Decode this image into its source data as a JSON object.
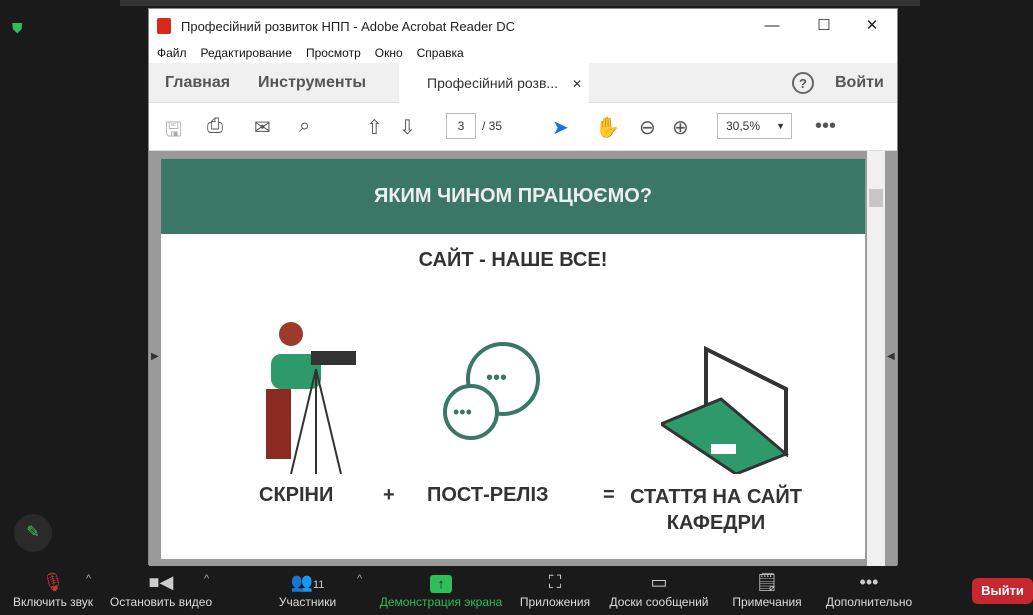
{
  "window": {
    "title": "Професійний розвиток НПП - Adobe Acrobat Reader DC",
    "minimize": "—",
    "maximize": "☐",
    "close": "✕"
  },
  "menu": [
    "Файл",
    "Редактирование",
    "Просмотр",
    "Окно",
    "Справка"
  ],
  "tabs": {
    "home": "Главная",
    "tools": "Инструменты",
    "doc": "Професійний розв...",
    "doc_close": "✕",
    "help": "?",
    "signin": "Войти"
  },
  "toolbar": {
    "page": "3",
    "total": "/ 35",
    "zoom": "30,5%"
  },
  "slide": {
    "banner": "ЯКИМ ЧИНОМ ПРАЦЮЄМО?",
    "subtitle": "САЙТ - НАШЕ ВСЕ!",
    "items": [
      "СКРІНИ",
      "+",
      "ПОСТ-РЕЛІЗ",
      "=",
      "СТАТТЯ НА САЙТ КАФЕДРИ"
    ]
  },
  "zoom_bar": {
    "items": [
      {
        "label": "Включить звук",
        "icon": "mic-muted-icon"
      },
      {
        "label": "Остановить видео",
        "icon": "video-icon"
      },
      {
        "label": "Участники",
        "icon": "participants-icon",
        "count": "11"
      },
      {
        "label": "Демонстрация экрана",
        "icon": "share-screen-icon"
      },
      {
        "label": "Приложения",
        "icon": "apps-icon"
      },
      {
        "label": "Доски сообщений",
        "icon": "whiteboard-icon"
      },
      {
        "label": "Примечания",
        "icon": "notes-icon"
      },
      {
        "label": "Дополнительно",
        "icon": "more-icon"
      }
    ],
    "leave": "Выйти",
    "accent": "#2dbd5a"
  }
}
